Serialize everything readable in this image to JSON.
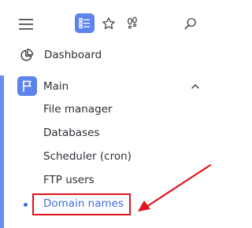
{
  "toolbar": {
    "icons": [
      "menu-icon",
      "list-view-icon",
      "star-icon",
      "footsteps-icon",
      "search-icon"
    ],
    "active_color": "#5d84ec"
  },
  "nav": {
    "dashboard": {
      "label": "Dashboard",
      "icon": "pie-chart-icon"
    },
    "main_section": {
      "label": "Main",
      "icon": "flag-icon",
      "expanded": true,
      "items": [
        {
          "label": "File manager"
        },
        {
          "label": "Databases"
        },
        {
          "label": "Scheduler (cron)"
        },
        {
          "label": "FTP users"
        },
        {
          "label": "Domain names",
          "active": true
        }
      ]
    }
  },
  "annotation": {
    "type": "highlight-box-with-arrow",
    "color": "#e0141d",
    "target": "Domain names"
  }
}
